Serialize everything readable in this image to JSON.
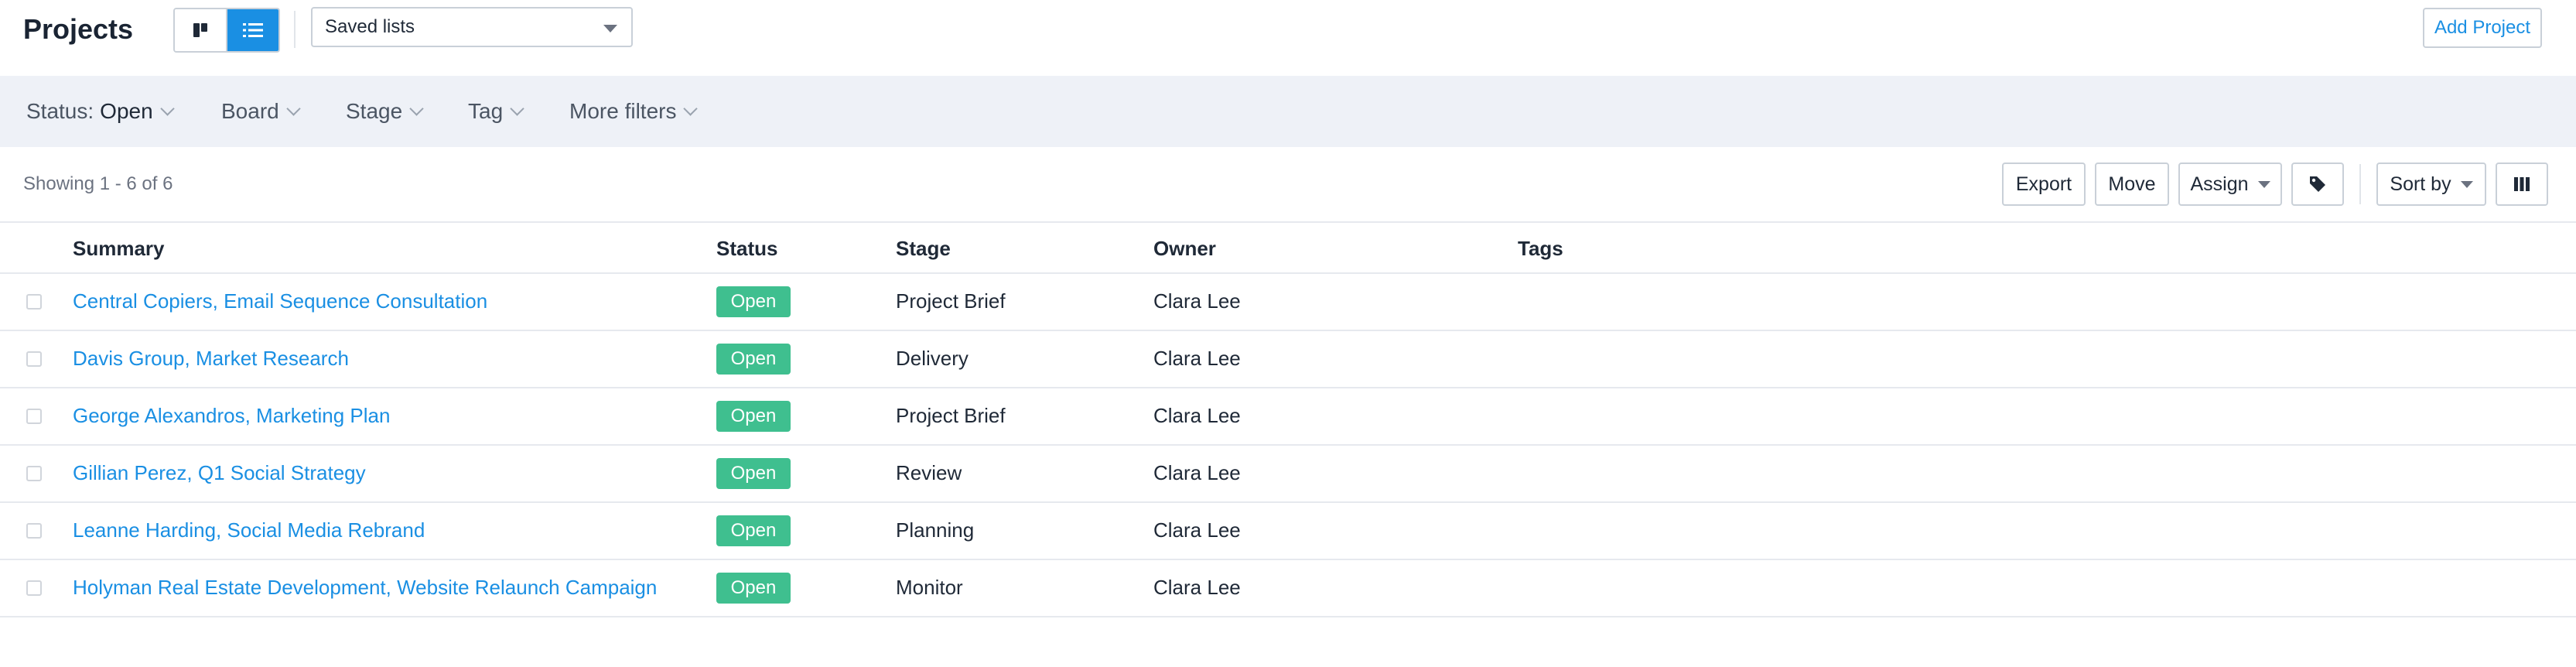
{
  "header": {
    "title": "Projects",
    "board_view_icon": "board-view-icon",
    "list_view_icon": "list-view-icon",
    "saved_lists_label": "Saved lists",
    "add_project_label": "Add Project",
    "active_view": "list"
  },
  "filters": {
    "status_label": "Status:",
    "status_value": "Open",
    "board_label": "Board",
    "stage_label": "Stage",
    "tag_label": "Tag",
    "more_label": "More filters"
  },
  "toolbar": {
    "showing": "Showing 1 - 6 of 6",
    "export_label": "Export",
    "move_label": "Move",
    "assign_label": "Assign",
    "tag_icon": "tag-icon",
    "sort_label": "Sort by",
    "columns_icon": "columns-icon"
  },
  "table": {
    "columns": [
      "Summary",
      "Status",
      "Stage",
      "Owner",
      "Tags"
    ],
    "rows": [
      {
        "summary": "Central Copiers, Email Sequence Consultation",
        "status": "Open",
        "stage": "Project Brief",
        "owner": "Clara Lee",
        "tags": ""
      },
      {
        "summary": "Davis Group, Market Research",
        "status": "Open",
        "stage": "Delivery",
        "owner": "Clara Lee",
        "tags": ""
      },
      {
        "summary": "George Alexandros, Marketing Plan",
        "status": "Open",
        "stage": "Project Brief",
        "owner": "Clara Lee",
        "tags": ""
      },
      {
        "summary": "Gillian Perez, Q1 Social Strategy",
        "status": "Open",
        "stage": "Review",
        "owner": "Clara Lee",
        "tags": ""
      },
      {
        "summary": "Leanne Harding, Social Media Rebrand",
        "status": "Open",
        "stage": "Planning",
        "owner": "Clara Lee",
        "tags": ""
      },
      {
        "summary": "Holyman Real Estate Development, Website Relaunch Campaign",
        "status": "Open",
        "stage": "Monitor",
        "owner": "Clara Lee",
        "tags": ""
      }
    ]
  },
  "colors": {
    "accent": "#1a8fe3",
    "status_open": "#3fbf8f",
    "filter_bar_bg": "#eef1f7"
  }
}
